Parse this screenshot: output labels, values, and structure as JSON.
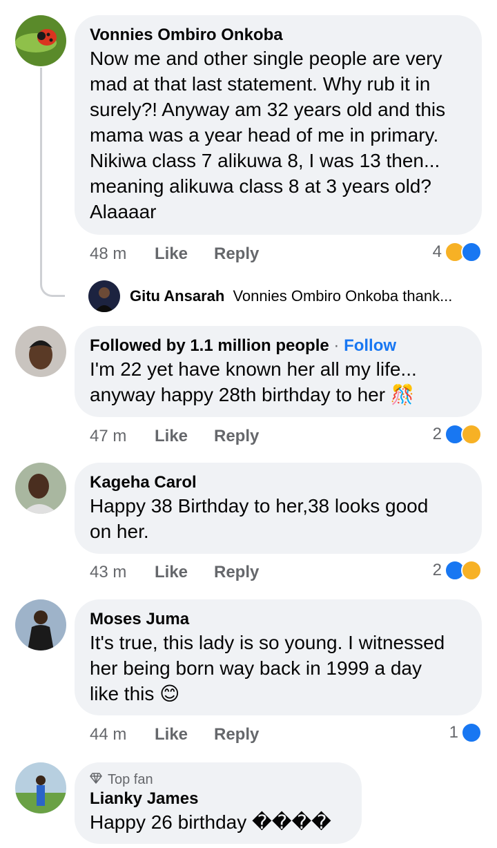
{
  "comments": [
    {
      "author": "Vonnies Ombiro Onkoba",
      "text": [
        "Now me and other single people are very",
        "mad at that last statement. Why rub it in",
        "surely?! Anyway am 32 years old and this",
        "mama was a year head of me in primary.",
        "Nikiwa class 7 alikuwa 8, I was 13 then...",
        "meaning alikuwa class 8 at 3 years old?",
        "Alaaaar"
      ],
      "time": "48 m",
      "like": "Like",
      "reply": "Reply",
      "reactions": "4"
    },
    {
      "author": "Followed by 1.1 million people",
      "follow_sep": "·",
      "follow": "Follow",
      "text": [
        "I'm 22 yet have known her all my life...",
        "anyway happy 28th birthday to her"
      ],
      "emoji": "🎊",
      "time": "47 m",
      "like": "Like",
      "reply": "Reply",
      "reactions": "2"
    },
    {
      "author": "Kageha Carol",
      "text": [
        "Happy 38 Birthday to her,38 looks good",
        "on her."
      ],
      "time": "43 m",
      "like": "Like",
      "reply": "Reply",
      "reactions": "2"
    },
    {
      "author": "Moses Juma",
      "text": [
        "It's true, this lady is so young. I witnessed",
        "her being born way back in 1999 a day",
        "like this"
      ],
      "emoji": "😊",
      "time": "44 m",
      "like": "Like",
      "reply": "Reply",
      "reactions": "1"
    },
    {
      "badge": "Top fan",
      "author": "Lianky James",
      "text": [
        "Happy 26 birthday ����"
      ]
    }
  ],
  "reply_preview": {
    "author": "Gitu Ansarah",
    "text": "Vonnies Ombiro Onkoba thank..."
  },
  "colors": {
    "link": "#1877f2",
    "bubble": "#f0f2f5",
    "meta": "#65676b"
  },
  "icons": {
    "like": "like-reaction-icon",
    "haha": "haha-reaction-icon",
    "top_fan": "diamond-icon"
  }
}
